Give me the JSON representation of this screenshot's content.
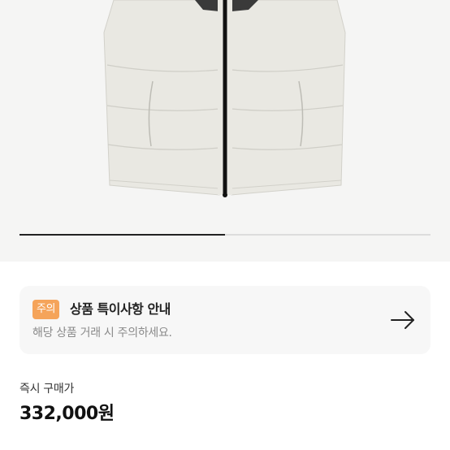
{
  "product": {
    "image_alt": "white puffer vest with black zipper",
    "colors": {
      "body": "#e9e8e2",
      "zipper": "#111111",
      "background": "#f5f5f4"
    }
  },
  "carousel": {
    "progress": 0.5
  },
  "notice": {
    "badge": "주의",
    "title": "상품 특이사항 안내",
    "description": "해당 상품 거래 시 주의하세요.",
    "arrow_icon": "arrow-right-icon",
    "badge_color": "#f5a45a"
  },
  "price": {
    "label": "즉시 구매가",
    "value": "332,000원"
  }
}
